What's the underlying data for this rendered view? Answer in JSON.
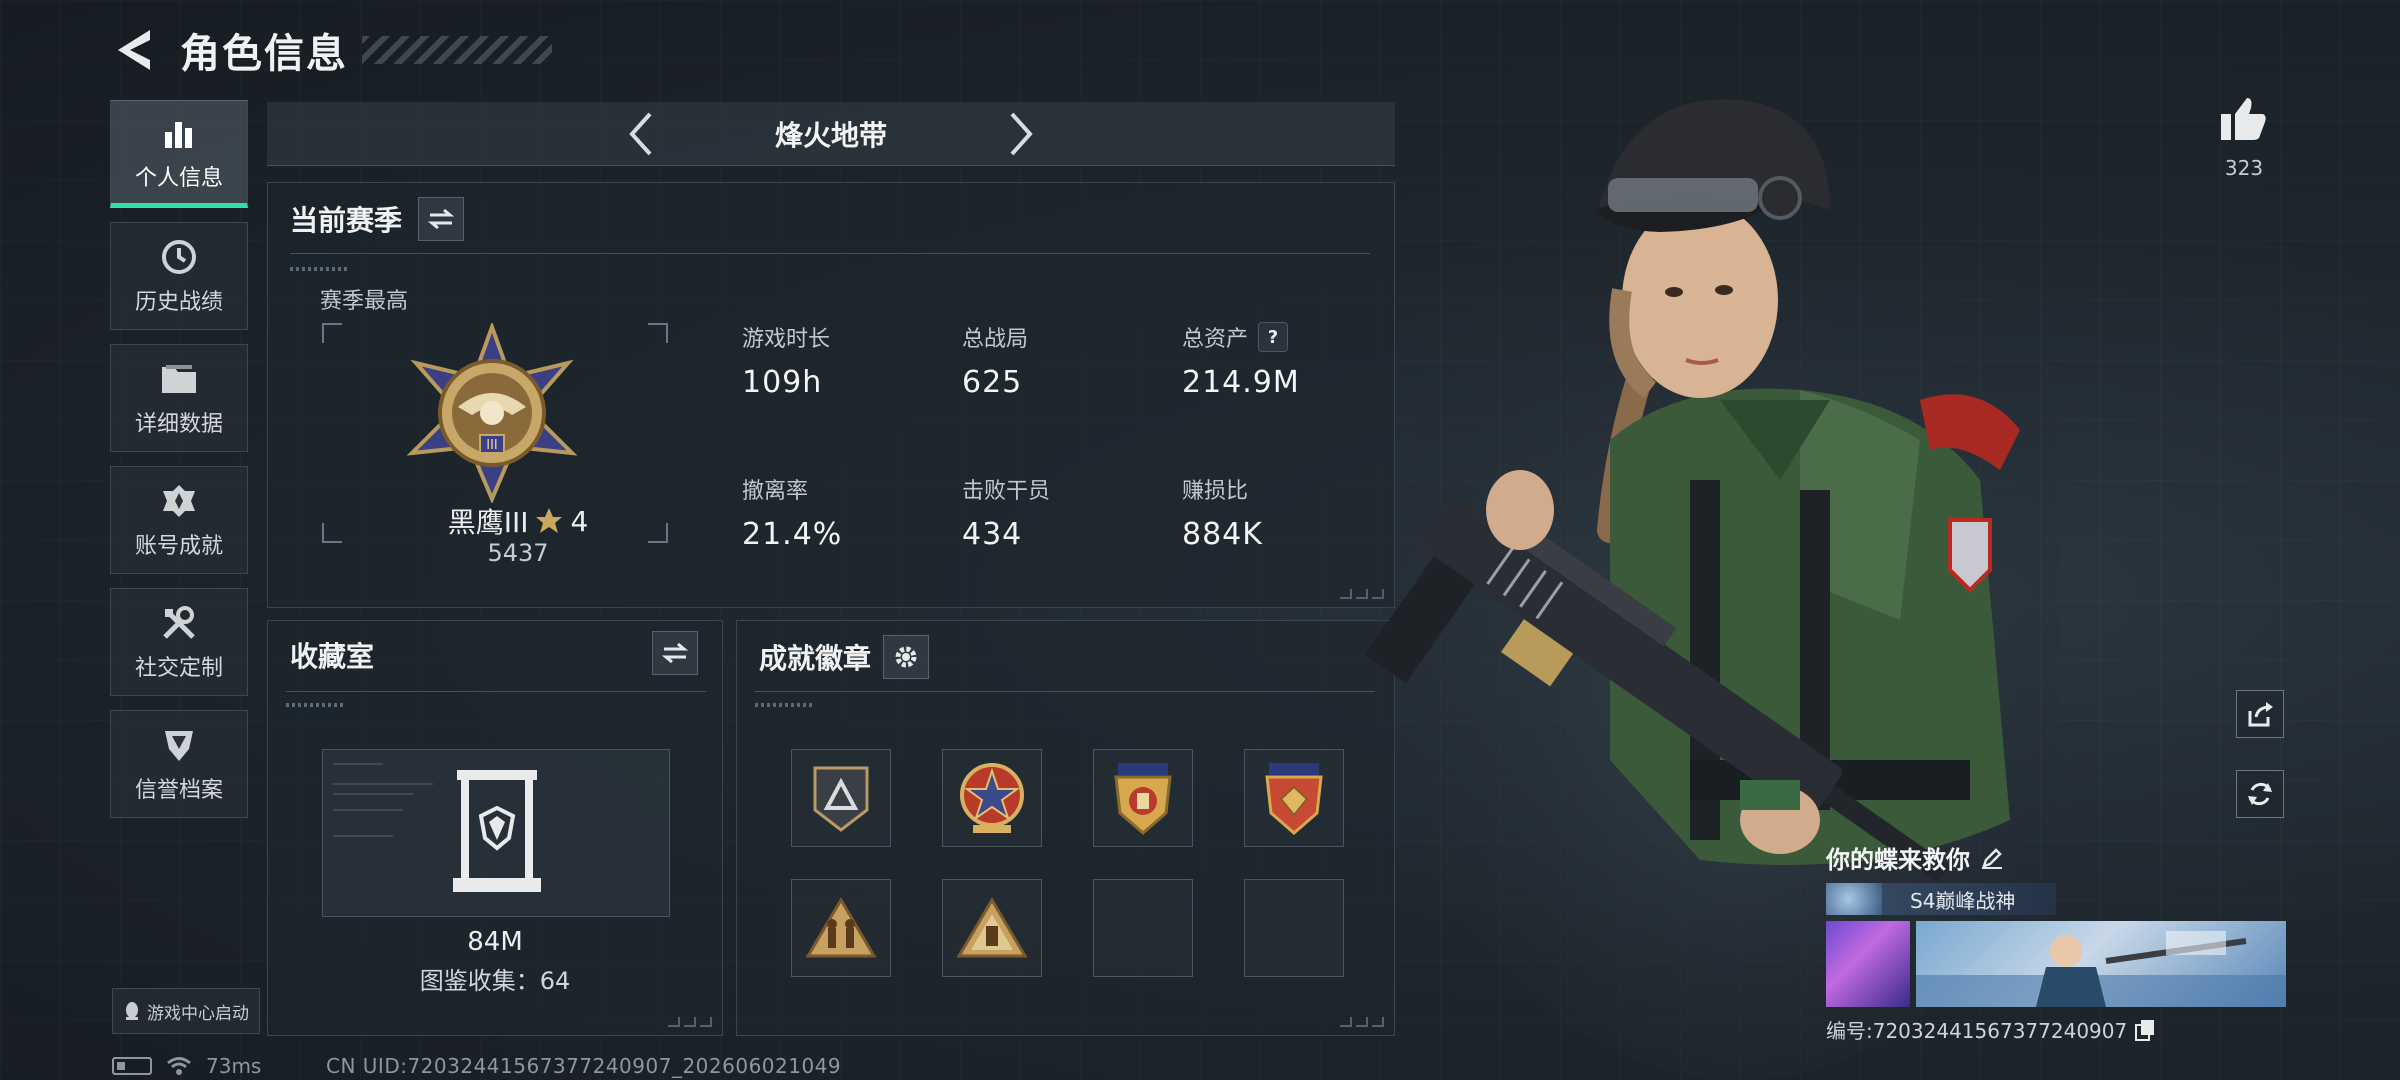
{
  "header": {
    "title": "角色信息"
  },
  "sidebar": {
    "items": [
      {
        "label": "个人信息",
        "icon": "bar-chart-icon",
        "active": true
      },
      {
        "label": "历史战绩",
        "icon": "clock-icon",
        "active": false
      },
      {
        "label": "详细数据",
        "icon": "folder-icon",
        "active": false
      },
      {
        "label": "账号成就",
        "icon": "achievement-icon",
        "active": false
      },
      {
        "label": "社交定制",
        "icon": "tools-icon",
        "active": false
      },
      {
        "label": "信誉档案",
        "icon": "shield-icon",
        "active": false
      }
    ],
    "launch_label": "游戏中心启动"
  },
  "mode": {
    "name": "烽火地带"
  },
  "season": {
    "title": "当前赛季",
    "best_label": "赛季最高",
    "rank_name": "黑鹰III",
    "rank_stars": "4",
    "rank_score": "5437",
    "stats": [
      {
        "label": "游戏时长",
        "value": "109h"
      },
      {
        "label": "总战局",
        "value": "625"
      },
      {
        "label": "总资产",
        "value": "214.9M",
        "help": "?"
      },
      {
        "label": "撤离率",
        "value": "21.4%"
      },
      {
        "label": "击败干员",
        "value": "434"
      },
      {
        "label": "赚损比",
        "value": "884K"
      }
    ]
  },
  "collection": {
    "title": "收藏室",
    "value": "84M",
    "count_text": "图鉴收集：64"
  },
  "badges": {
    "title": "成就徽章",
    "slots": [
      {
        "icon": "triangle-badge-icon",
        "filled": true
      },
      {
        "icon": "star-medal-badge-icon",
        "filled": true
      },
      {
        "icon": "wing-medal-badge-icon",
        "filled": true
      },
      {
        "icon": "gem-medal-badge-icon",
        "filled": true
      },
      {
        "icon": "soldiers-badge-icon",
        "filled": true
      },
      {
        "icon": "tower-badge-icon",
        "filled": true
      },
      {
        "icon": "empty-slot",
        "filled": false
      },
      {
        "icon": "empty-slot",
        "filled": false
      }
    ]
  },
  "status_bar": {
    "ping": "73ms",
    "uid": "CN UID:72032441567377240907_202606021049"
  },
  "profile": {
    "likes": "323",
    "player_name": "你的蝶来救你",
    "title_tag": "S4巅峰战神",
    "id_text": "编号:72032441567377240907"
  },
  "colors": {
    "accent": "#2fe0a8",
    "panel_bg": "#1e262d",
    "border": "#3a454e"
  }
}
